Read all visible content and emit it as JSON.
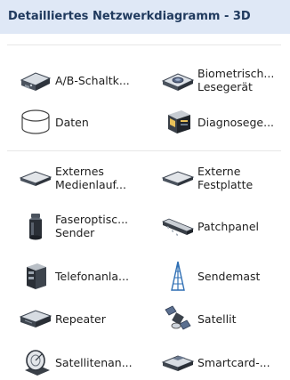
{
  "header": {
    "title": "Detailliertes Netzwerkdiagramm - 3D"
  },
  "items": [
    {
      "line1": "A/B-Schaltk...",
      "line2": "",
      "icon": "ab-switch-icon"
    },
    {
      "line1": "Biometrisch...",
      "line2": "Lesegerät",
      "icon": "biometric-reader-icon"
    },
    {
      "line1": "Daten",
      "line2": "",
      "icon": "data-store-icon"
    },
    {
      "line1": "Diagnosege...",
      "line2": "",
      "icon": "diagnostic-device-icon"
    },
    {
      "line1": "Externes",
      "line2": "Medienlauf...",
      "icon": "external-media-drive-icon"
    },
    {
      "line1": "Externe",
      "line2": "Festplatte",
      "icon": "external-hard-drive-icon"
    },
    {
      "line1": "Faseroptisc...",
      "line2": "Sender",
      "icon": "fiber-optic-transmitter-icon"
    },
    {
      "line1": "Patchpanel",
      "line2": "",
      "icon": "patch-panel-icon"
    },
    {
      "line1": "Telefonanla...",
      "line2": "",
      "icon": "phone-system-icon"
    },
    {
      "line1": "Sendemast",
      "line2": "",
      "icon": "radio-tower-icon"
    },
    {
      "line1": "Repeater",
      "line2": "",
      "icon": "repeater-icon"
    },
    {
      "line1": "Satellit",
      "line2": "",
      "icon": "satellite-icon"
    },
    {
      "line1": "Satellitenan...",
      "line2": "",
      "icon": "satellite-dish-icon"
    },
    {
      "line1": "Smartcard-...",
      "line2": "",
      "icon": "smartcard-reader-icon"
    }
  ]
}
